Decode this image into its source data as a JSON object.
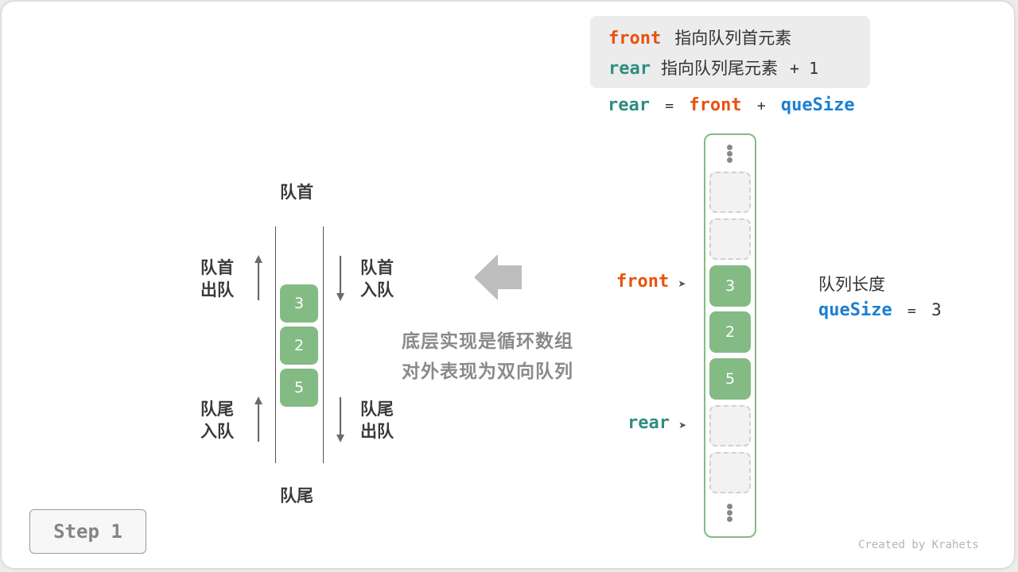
{
  "legend": {
    "front_keyword": "front",
    "front_desc": "指向队列首元素",
    "rear_keyword": "rear",
    "rear_desc": "指向队列尾元素",
    "rear_suffix": "+ 1"
  },
  "formula": {
    "lhs": "rear",
    "eq": "=",
    "front": "front",
    "plus": "+",
    "size": "queSize"
  },
  "deque": {
    "top_label": "队首",
    "bottom_label": "队尾",
    "front_dequeue": [
      "队首",
      "出队"
    ],
    "front_enqueue": [
      "队首",
      "入队"
    ],
    "rear_enqueue": [
      "队尾",
      "入队"
    ],
    "rear_dequeue": [
      "队尾",
      "出队"
    ],
    "items": [
      "3",
      "2",
      "5"
    ]
  },
  "note": {
    "line1": "底层实现是循环数组",
    "line2": "对外表现为双向队列"
  },
  "array": {
    "slots": [
      "",
      "",
      "3",
      "2",
      "5",
      "",
      ""
    ],
    "front_pointer": "front",
    "rear_pointer": "rear",
    "pointer_arrow": "➤"
  },
  "size_info": {
    "label": "队列长度",
    "keyword": "queSize",
    "eq": "=",
    "value": "3"
  },
  "step_button": "Step 1",
  "credit": "Created by Krahets",
  "colors": {
    "front": "#e8520f",
    "rear": "#2f8c80",
    "queSize": "#1b7fd1",
    "cell_fill": "#84bb84"
  }
}
